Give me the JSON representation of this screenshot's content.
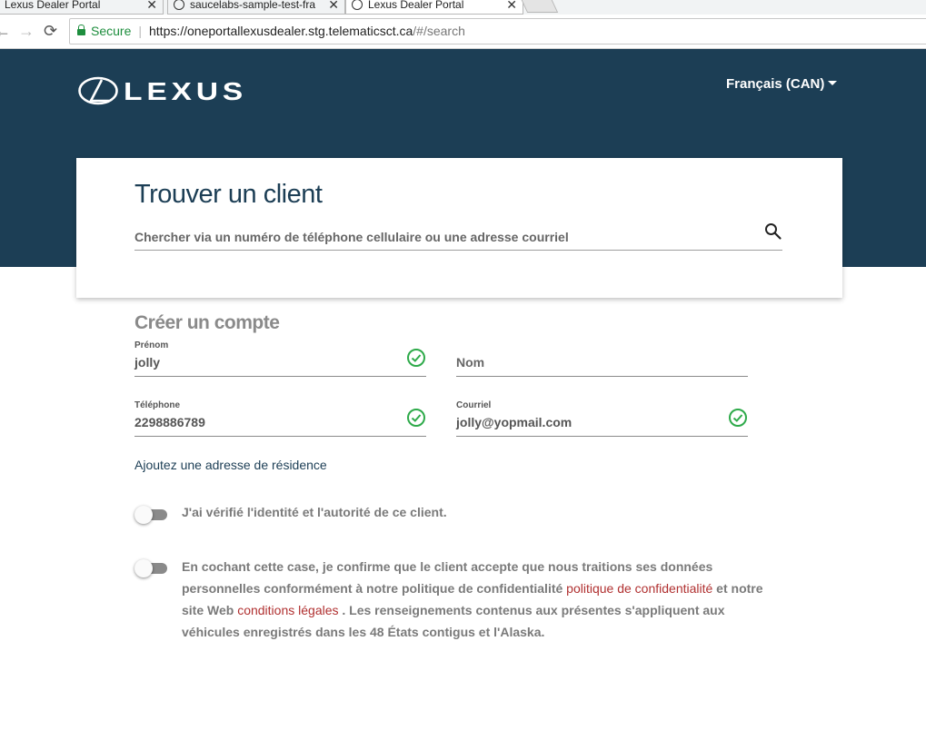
{
  "browser": {
    "tabs": [
      {
        "title": "Lexus Dealer Portal",
        "close": "✕"
      },
      {
        "title": "saucelabs-sample-test-fra",
        "close": "✕"
      },
      {
        "title": "Lexus Dealer Portal",
        "close": "✕"
      }
    ],
    "back": "←",
    "forward": "→",
    "reload": "⟳",
    "secure_label": "Secure",
    "url_host": "https://oneportallexusdealer.stg.telematicsct.ca",
    "url_path": "/#/search"
  },
  "header": {
    "logo_text": "LEXUS",
    "language": "Français (CAN)"
  },
  "search_card": {
    "title": "Trouver un client",
    "placeholder": "Chercher via un numéro de téléphone cellulaire ou une adresse courriel"
  },
  "create_account": {
    "title": "Créer un compte",
    "fields": [
      {
        "label": "Prénom",
        "value": "jolly",
        "valid": true
      },
      {
        "label": "",
        "placeholder": "Nom",
        "value": "",
        "valid": false
      },
      {
        "label": "Téléphone",
        "value": "2298886789",
        "valid": true
      },
      {
        "label": "Courriel",
        "value": "jolly@yopmail.com",
        "valid": true
      }
    ],
    "add_address_link": "Ajoutez une adresse de résidence",
    "identity_toggle_label": "J'ai vérifié l'identité et l'autorité de ce client.",
    "consent": {
      "part1": "En cochant cette case, je confirme que le client accepte que nous traitions ses données personnelles conformément à notre politique de confidentialité ",
      "privacy_link": "politique de confidentialité",
      "part2": " et notre site Web ",
      "legal_link": "conditions légales",
      "part3": " . Les renseignements contenus aux présentes s'appliquent aux véhicules enregistrés dans les 48 États contigus et l'Alaska."
    }
  },
  "colors": {
    "hero": "#1c3e55",
    "check": "#2eaa4a",
    "link_red": "#b03030"
  }
}
